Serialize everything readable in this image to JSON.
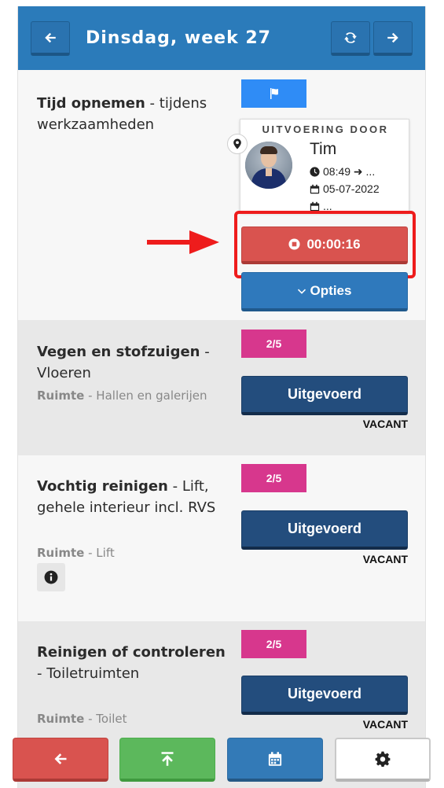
{
  "header": {
    "title": "Dinsdag, week 27",
    "back_icon": "arrow-left-icon",
    "refresh_icon": "refresh-icon",
    "forward_icon": "arrow-right-icon",
    "color": "#2b7bba"
  },
  "active_task": {
    "name_bold": "Tijd opnemen",
    "name_rest": " - tijdens werkzaamheden",
    "tag_icon": "flag-icon",
    "executed_by_label": "UITVOERING DOOR",
    "executor_name": "Tim",
    "time": "08:49 ➜ ...",
    "date": "05-07-2022",
    "extra": "...",
    "timer": "00:00:16",
    "options_label": "Opties"
  },
  "tasks": [
    {
      "name_bold": "Vegen en stofzuigen",
      "name_rest": " - Vloeren",
      "room_label": "Ruimte",
      "room_value": " - Hallen en galerijen",
      "count": "2/5",
      "button": "Uitgevoerd",
      "status": "VACANT"
    },
    {
      "name_bold": "Vochtig reinigen",
      "name_rest": " - Lift, gehele interieur incl. RVS",
      "room_label": "Ruimte",
      "room_value": " - Lift",
      "count": "2/5",
      "button": "Uitgevoerd",
      "status": "VACANT"
    },
    {
      "name_bold": "Reinigen of controleren",
      "name_rest": " - Toiletruimten",
      "room_label": "Ruimte",
      "room_value": " - Toilet",
      "count": "2/5",
      "button": "Uitgevoerd",
      "status": "VACANT"
    }
  ],
  "alert": {
    "symbol": "!",
    "color": "#e74b3c"
  },
  "footer": {
    "back_icon": "arrow-left-icon",
    "top_icon": "arrow-up-to-top-icon",
    "calendar_icon": "calendar-icon",
    "settings_icon": "gear-icon"
  }
}
